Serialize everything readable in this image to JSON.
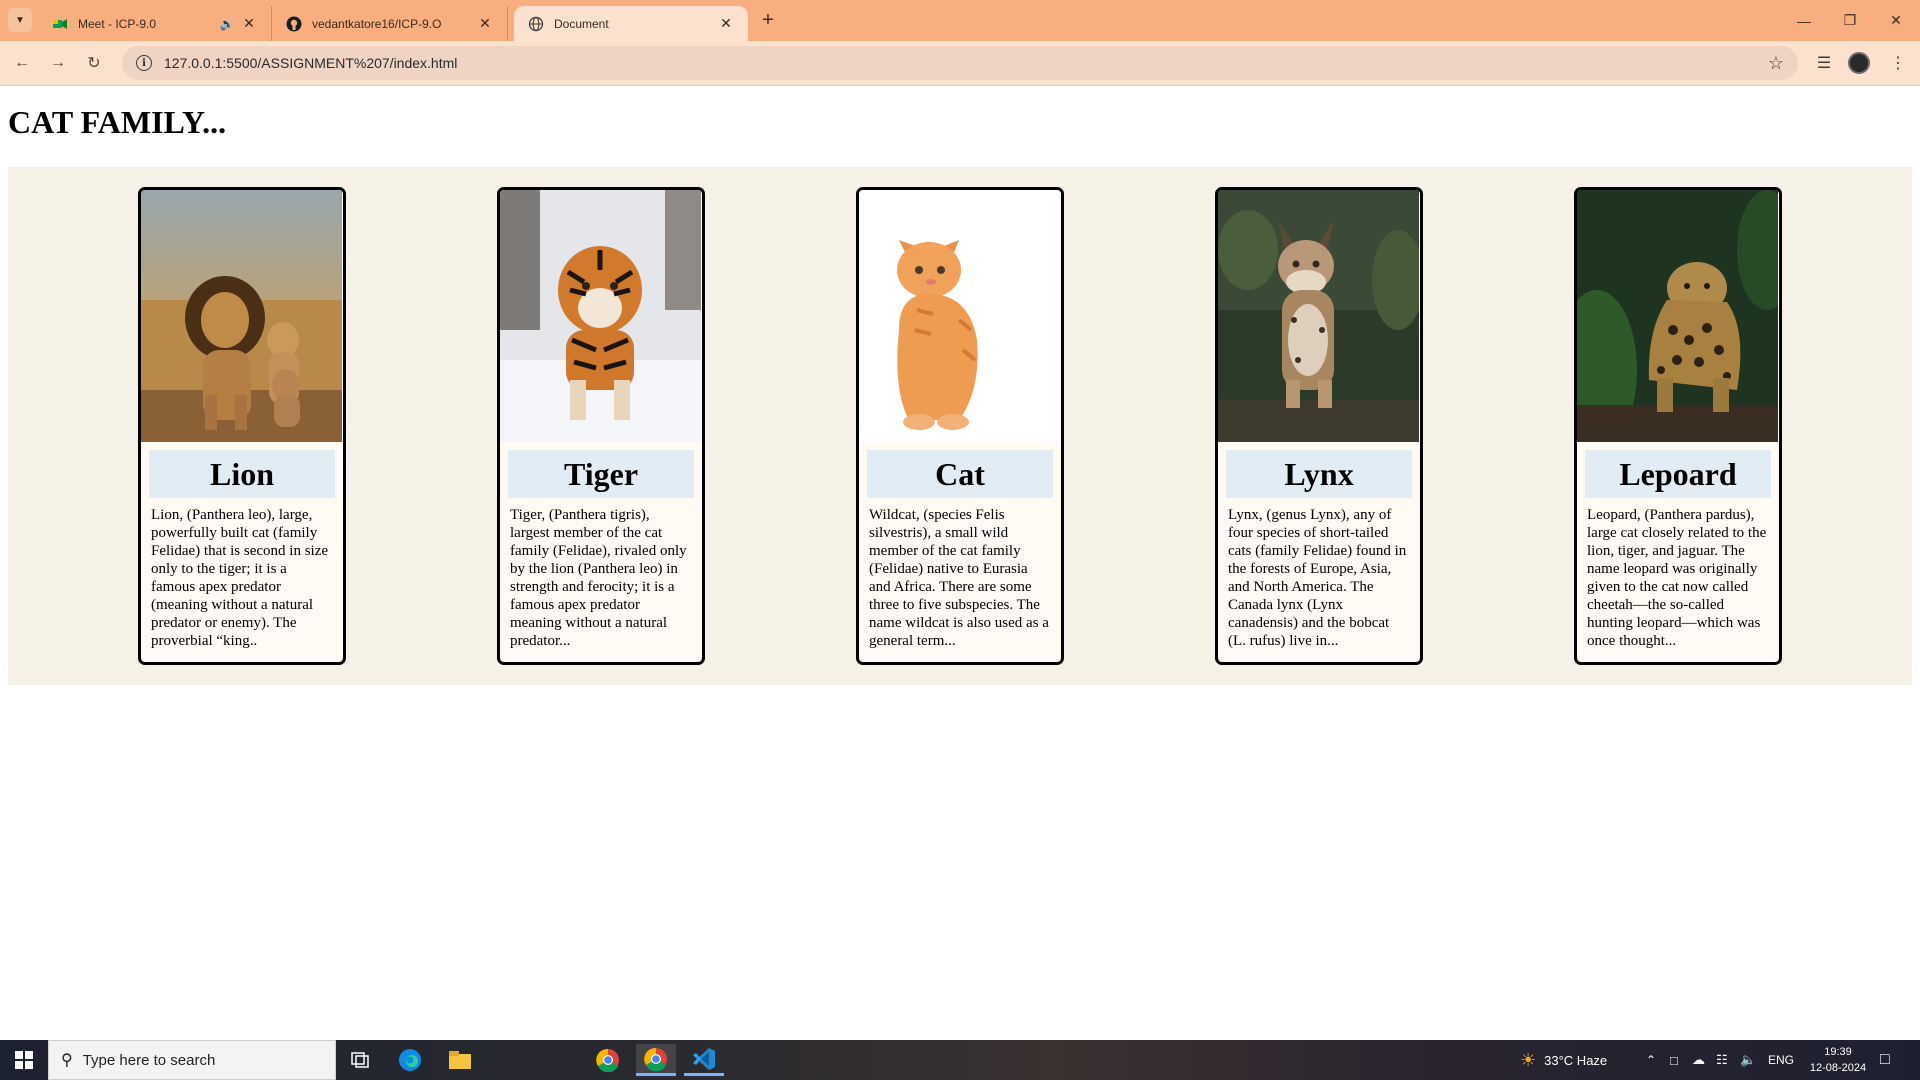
{
  "browser": {
    "tabs": [
      {
        "title": "Meet - ICP-9.0",
        "icon": "google-meet-icon",
        "audio_icon": "speaker-icon"
      },
      {
        "title": "vedantkatore16/ICP-9.O",
        "icon": "github-icon"
      },
      {
        "title": "Document",
        "icon": "globe-icon",
        "active": true
      }
    ],
    "url": "127.0.0.1:5500/ASSIGNMENT%207/index.html",
    "accent": "#f8ae7f"
  },
  "page": {
    "heading": "CAT FAMILY...",
    "cards": [
      {
        "name": "Lion",
        "image": "lion-photo",
        "description": "Lion, (Panthera leo), large, powerfully built cat (family Felidae) that is second in size only to the tiger; it is a famous apex predator (meaning without a natural predator or enemy). The proverbial “king.."
      },
      {
        "name": "Tiger",
        "image": "tiger-photo",
        "description": "Tiger, (Panthera tigris), largest member of the cat family (Felidae), rivaled only by the lion (Panthera leo) in strength and ferocity; it is a famous apex predator meaning without a natural predator..."
      },
      {
        "name": "Cat",
        "image": "kitten-photo",
        "description": "Wildcat, (species Felis silvestris), a small wild member of the cat family (Felidae) native to Eurasia and Africa. There are some three to five subspecies. The name wildcat is also used as a general term..."
      },
      {
        "name": "Lynx",
        "image": "lynx-photo",
        "description": "Lynx, (genus Lynx), any of four species of short-tailed cats (family Felidae) found in the forests of Europe, Asia, and North America. The Canada lynx (Lynx canadensis) and the bobcat (L. rufus) live in..."
      },
      {
        "name": "Lepoard",
        "image": "leopard-photo",
        "description": "Leopard, (Panthera pardus), large cat closely related to the lion, tiger, and jaguar. The name leopard was originally given to the cat now called cheetah—the so-called hunting leopard—which was once thought..."
      }
    ],
    "section_bg": "#f6f1e6",
    "name_box_bg": "#e1ecf4"
  },
  "taskbar": {
    "search_placeholder": "Type here to search",
    "weather": "33°C  Haze",
    "language": "ENG",
    "time": "19:39",
    "date": "12-08-2024"
  }
}
